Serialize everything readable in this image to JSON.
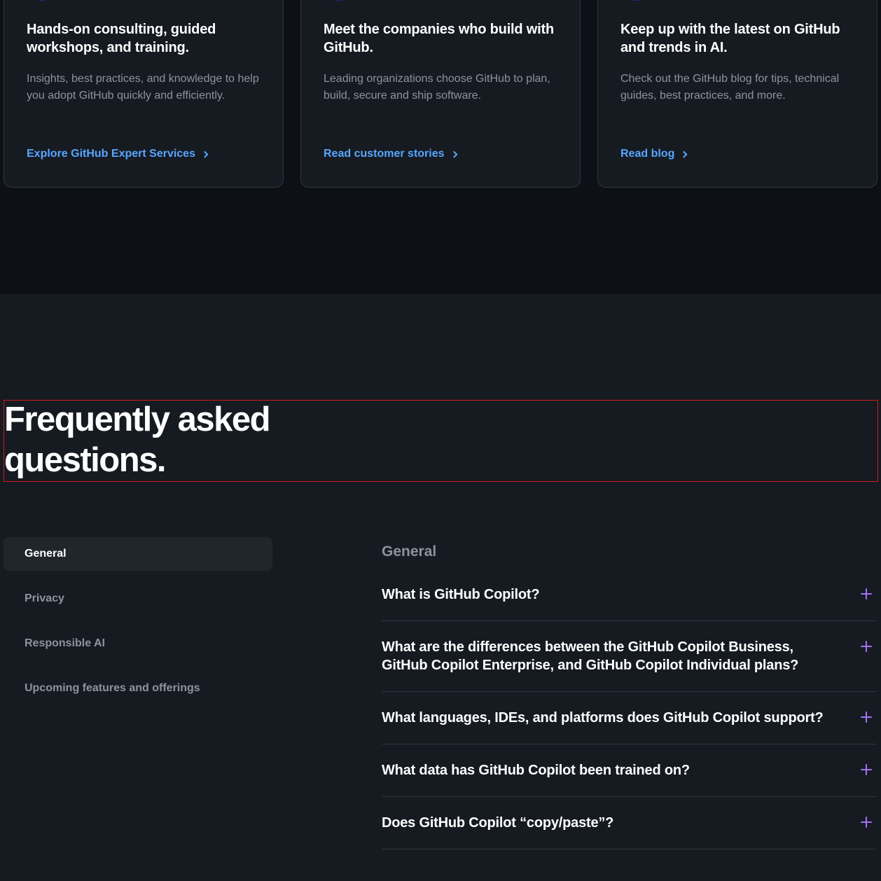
{
  "cards": [
    {
      "title": "Hands-on consulting, guided workshops, and training.",
      "description": "Insights, best practices, and knowledge to help you adopt GitHub quickly and efficiently.",
      "link": "Explore GitHub Expert Services"
    },
    {
      "title": "Meet the companies who build with GitHub.",
      "description": "Leading organizations choose GitHub to plan, build, secure and ship software.",
      "link": "Read customer stories"
    },
    {
      "title": "Keep up with the latest on GitHub and trends in AI.",
      "description": "Check out the GitHub blog for tips, technical guides, best practices, and more.",
      "link": "Read blog"
    }
  ],
  "faq": {
    "heading": "Frequently asked questions.",
    "categories": [
      {
        "label": "General",
        "active": true
      },
      {
        "label": "Privacy",
        "active": false
      },
      {
        "label": "Responsible AI",
        "active": false
      },
      {
        "label": "Upcoming features and offerings",
        "active": false
      }
    ],
    "panel_title": "General",
    "questions": [
      "What is GitHub Copilot?",
      "What are the differences between the GitHub Copilot Business, GitHub Copilot Enterprise, and GitHub Copilot Individual plans?",
      "What languages, IDEs, and platforms does GitHub Copilot support?",
      "What data has GitHub Copilot been trained on?",
      "Does GitHub Copilot “copy/paste”?"
    ]
  },
  "colors": {
    "page_bg": "#161b22",
    "top_section_bg": "#0d1117",
    "link": "#58a6ff",
    "accent_plus": "#a371f7",
    "muted_text": "#8b949e"
  },
  "icons": {
    "card_icon": "purple-circle-icon",
    "link_chevron": "chevron-right-icon",
    "expand": "plus-icon"
  }
}
